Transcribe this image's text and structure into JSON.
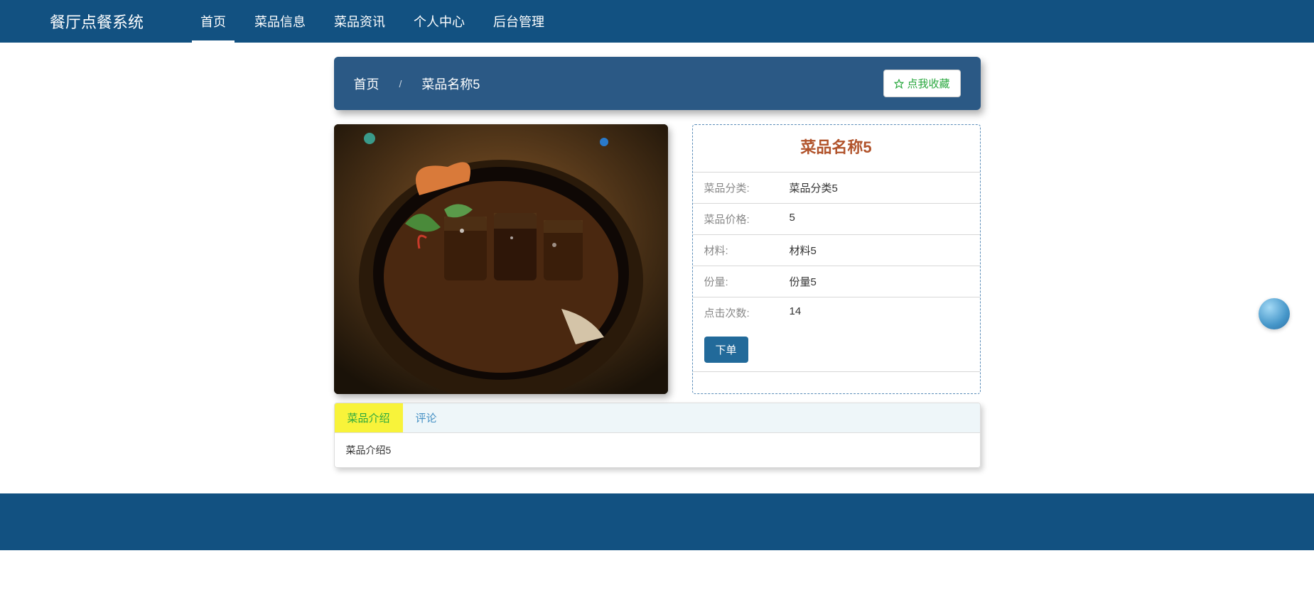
{
  "navbar": {
    "brand": "餐厅点餐系统",
    "items": [
      {
        "label": "首页",
        "active": true
      },
      {
        "label": "菜品信息",
        "active": false
      },
      {
        "label": "菜品资讯",
        "active": false
      },
      {
        "label": "个人中心",
        "active": false
      },
      {
        "label": "后台管理",
        "active": false
      }
    ]
  },
  "breadcrumb": {
    "home": "首页",
    "current": "菜品名称5"
  },
  "favorite_label": "点我收藏",
  "dish": {
    "title": "菜品名称5",
    "fields": [
      {
        "label": "菜品分类:",
        "value": "菜品分类5"
      },
      {
        "label": "菜品价格:",
        "value": "5"
      },
      {
        "label": "材料:",
        "value": "材料5"
      },
      {
        "label": "份量:",
        "value": "份量5"
      },
      {
        "label": "点击次数:",
        "value": "14"
      }
    ],
    "order_button": "下单"
  },
  "tabs": {
    "items": [
      {
        "label": "菜品介绍",
        "active": true
      },
      {
        "label": "评论",
        "active": false
      }
    ],
    "content": "菜品介绍5"
  }
}
